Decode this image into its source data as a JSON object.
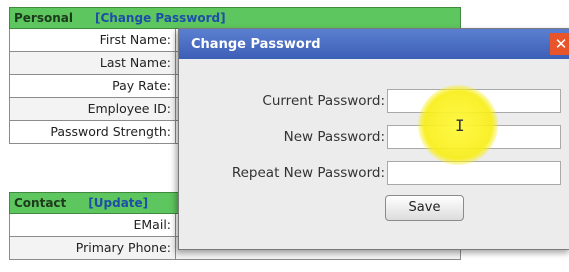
{
  "personal": {
    "title": "Personal",
    "link": "[Change Password]",
    "rows": [
      {
        "label": "First Name:"
      },
      {
        "label": "Last Name:"
      },
      {
        "label": "Pay Rate:"
      },
      {
        "label": "Employee ID:"
      },
      {
        "label": "Password Strength:"
      }
    ]
  },
  "contact": {
    "title": "Contact",
    "link": "[Update]",
    "rows": [
      {
        "label": "EMail:"
      },
      {
        "label": "Primary Phone:"
      }
    ]
  },
  "dialog": {
    "title": "Change Password",
    "close": "✕",
    "current_label": "Current Password:",
    "new_label": "New Password:",
    "repeat_label": "Repeat New Password:",
    "save_label": "Save"
  },
  "cursor": {
    "icon": "text-cursor-icon",
    "glyph": "I"
  }
}
